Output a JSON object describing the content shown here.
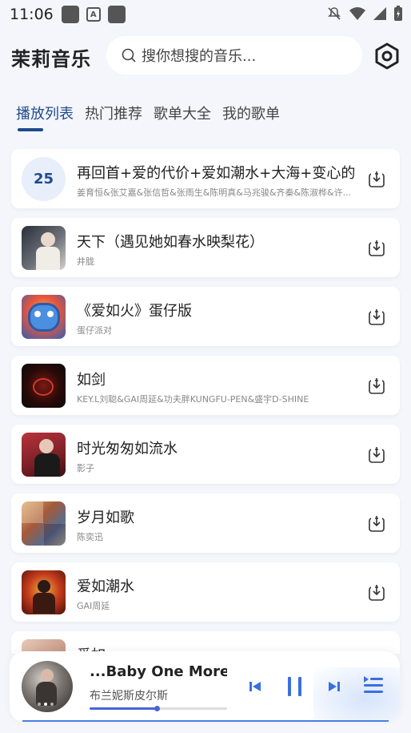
{
  "status_bar": {
    "time": "11:06"
  },
  "app": {
    "title": "茉莉音乐"
  },
  "search": {
    "placeholder": "搜你想搜的音乐..."
  },
  "tabs": [
    {
      "label": "播放列表",
      "active": true
    },
    {
      "label": "热门推荐",
      "active": false
    },
    {
      "label": "歌单大全",
      "active": false
    },
    {
      "label": "我的歌单",
      "active": false
    }
  ],
  "songs": [
    {
      "rank": "25",
      "title": "再回首+爱的代价+爱如潮水+大海+变心的",
      "artist": "姜育恒&张艾嘉&张信哲&张雨生&陈明真&马兆骏&齐秦&陈淑桦&许..."
    },
    {
      "title": "天下（遇见她如春水映梨花）",
      "artist": "井胧"
    },
    {
      "title": "《爱如火》蛋仔版",
      "artist": "蛋仔派对"
    },
    {
      "title": "如剑",
      "artist": "KEY.L刘聪&GAI周延&功夫胖KUNGFU-PEN&盛宇D-SHINE"
    },
    {
      "title": "时光匆匆如流水",
      "artist": "影子"
    },
    {
      "title": "岁月如歌",
      "artist": "陈奕迅"
    },
    {
      "title": "爱如潮水",
      "artist": "GAI周延"
    },
    {
      "title": "爱如……",
      "artist": ""
    }
  ],
  "player": {
    "title": "...Baby One More Tir",
    "artist": "布兰妮斯皮尔斯",
    "progress": 0.49
  },
  "colors": {
    "accent": "#1f4b8e",
    "player_accent": "#4a63d6"
  }
}
